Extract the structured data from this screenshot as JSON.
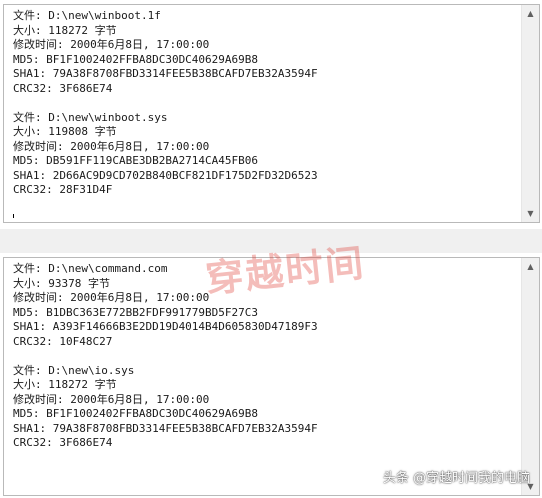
{
  "top_pane": {
    "lines": [
      "文件: D:\\new\\winboot.1f",
      "大小: 118272 字节",
      "修改时间: 2000年6月8日, 17:00:00",
      "MD5: BF1F1002402FFBA8DC30DC40629A69B8",
      "SHA1: 79A38F8708FBD3314FEE5B38BCAFD7EB32A3594F",
      "CRC32: 3F686E74",
      "",
      "文件: D:\\new\\winboot.sys",
      "大小: 119808 字节",
      "修改时间: 2000年6月8日, 17:00:00",
      "MD5: DB591FF119CABE3DB2BA2714CA45FB06",
      "SHA1: 2D66AC9D9CD702B840BCF821DF175D2FD32D6523",
      "CRC32: 28F31D4F"
    ]
  },
  "bottom_pane": {
    "lines": [
      "文件: D:\\new\\command.com",
      "大小: 93378 字节",
      "修改时间: 2000年6月8日, 17:00:00",
      "MD5: B1DBC363E772BB2FDF991779BD5F27C3",
      "SHA1: A393F14666B3E2DD19D4014B4D605830D47189F3",
      "CRC32: 10F48C27",
      "",
      "文件: D:\\new\\io.sys",
      "大小: 118272 字节",
      "修改时间: 2000年6月8日, 17:00:00",
      "MD5: BF1F1002402FFBA8DC30DC40629A69B8",
      "SHA1: 79A38F8708FBD3314FEE5B38BCAFD7EB32A3594F",
      "CRC32: 3F686E74"
    ]
  },
  "scrollbar": {
    "up_icon": "▲",
    "down_icon": "▼"
  },
  "watermark": {
    "text": "穿越时间"
  },
  "credit": {
    "text": "头条 @穿越时间我的电脑"
  }
}
